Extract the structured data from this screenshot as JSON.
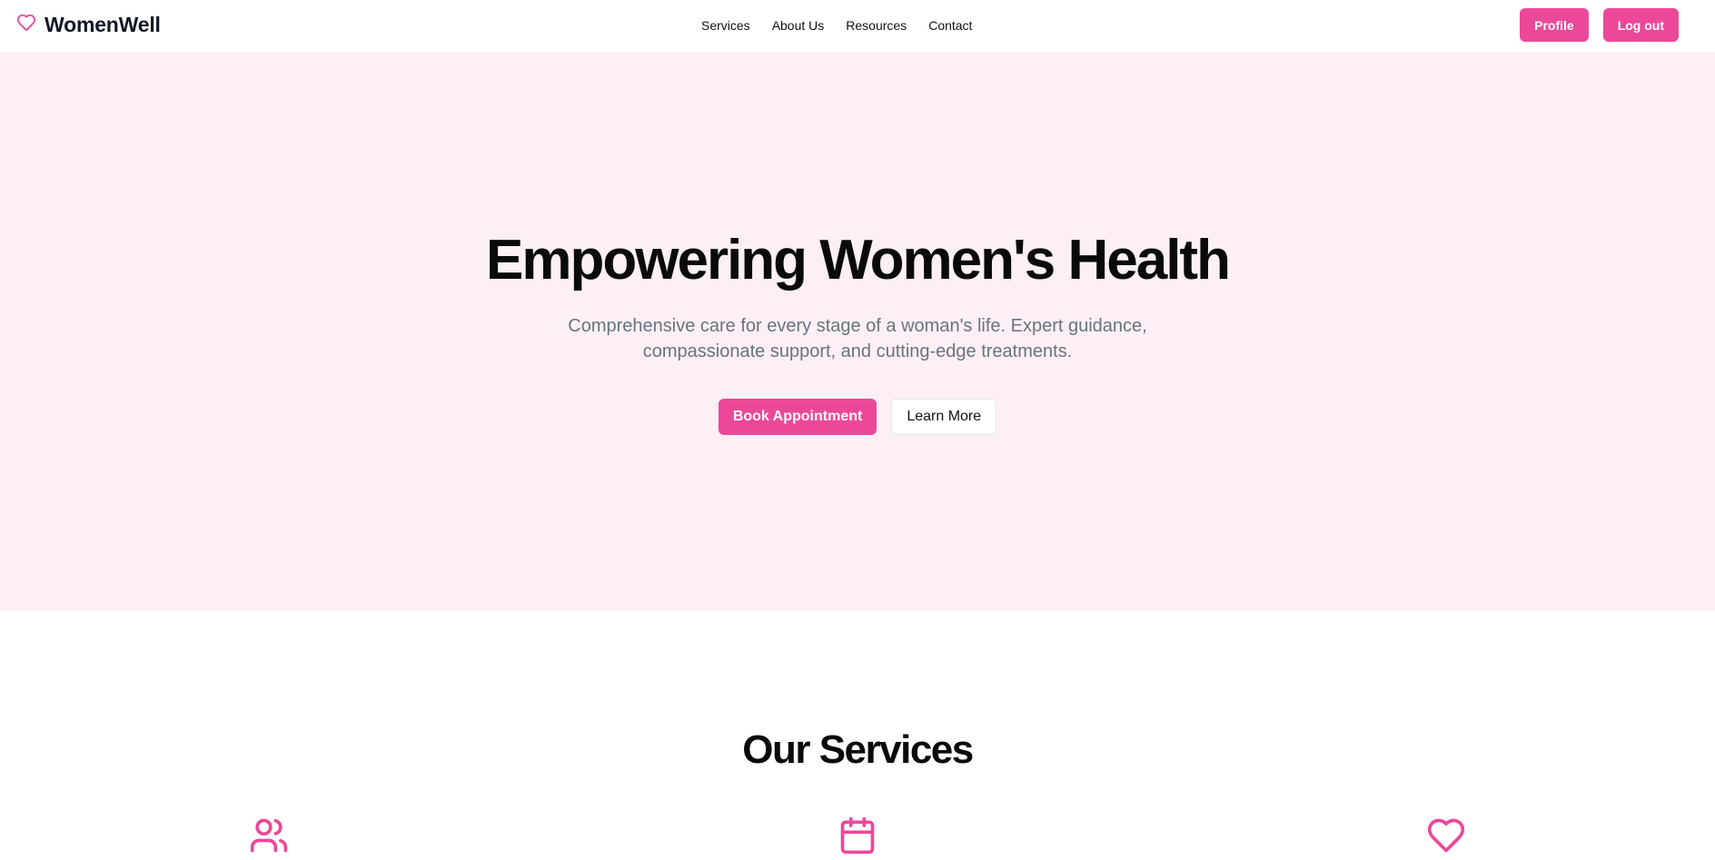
{
  "brand": {
    "name": "WomenWell",
    "icon": "heart-icon",
    "accent_color": "#ec4899"
  },
  "nav": {
    "links": [
      "Services",
      "About Us",
      "Resources",
      "Contact"
    ]
  },
  "header_actions": {
    "profile_label": "Profile",
    "logout_label": "Log out"
  },
  "hero": {
    "title": "Empowering Women's Health",
    "subtitle": "Comprehensive care for every stage of a woman's life. Expert guidance, compassionate support, and cutting-edge treatments.",
    "primary_cta": "Book Appointment",
    "secondary_cta": "Learn More",
    "background_color": "#fcf0f6"
  },
  "services": {
    "title": "Our Services",
    "icons": [
      "users-icon",
      "calendar-icon",
      "heart-icon"
    ]
  }
}
